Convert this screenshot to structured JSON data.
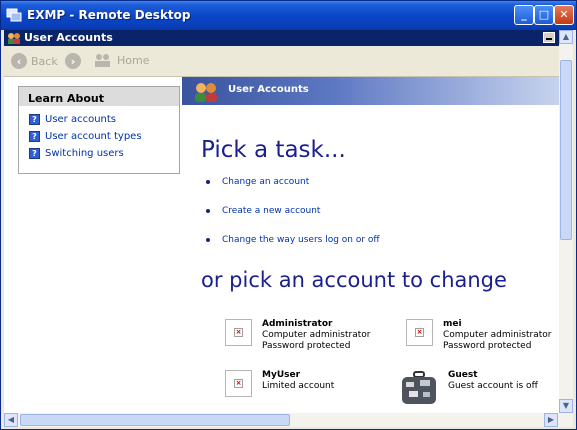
{
  "window": {
    "title": "EXMP - Remote Desktop"
  },
  "inner_window": {
    "title": "User Accounts"
  },
  "toolbar": {
    "back_label": "Back",
    "home_label": "Home"
  },
  "learn_about": {
    "heading": "Learn About",
    "links": [
      "User accounts",
      "User account types",
      "Switching users"
    ]
  },
  "main": {
    "header_title": "User Accounts",
    "pick_task": "Pick a task...",
    "tasks": [
      "Change an account",
      "Create a new account",
      "Change the way users log on or off"
    ],
    "pick_account": "or pick an account to change",
    "accounts": [
      {
        "name": "Administrator",
        "line1": "Computer administrator",
        "line2": "Password protected"
      },
      {
        "name": "mei",
        "line1": "Computer administrator",
        "line2": "Password protected"
      },
      {
        "name": "MyUser",
        "line1": "Limited account",
        "line2": ""
      },
      {
        "name": "Guest",
        "line1": "Guest account is off",
        "line2": ""
      }
    ]
  },
  "colors": {
    "title_bar": "#0a46c8",
    "inner_title": "#0a246a",
    "heading_text": "#1a1f90",
    "link": "#0033aa"
  }
}
